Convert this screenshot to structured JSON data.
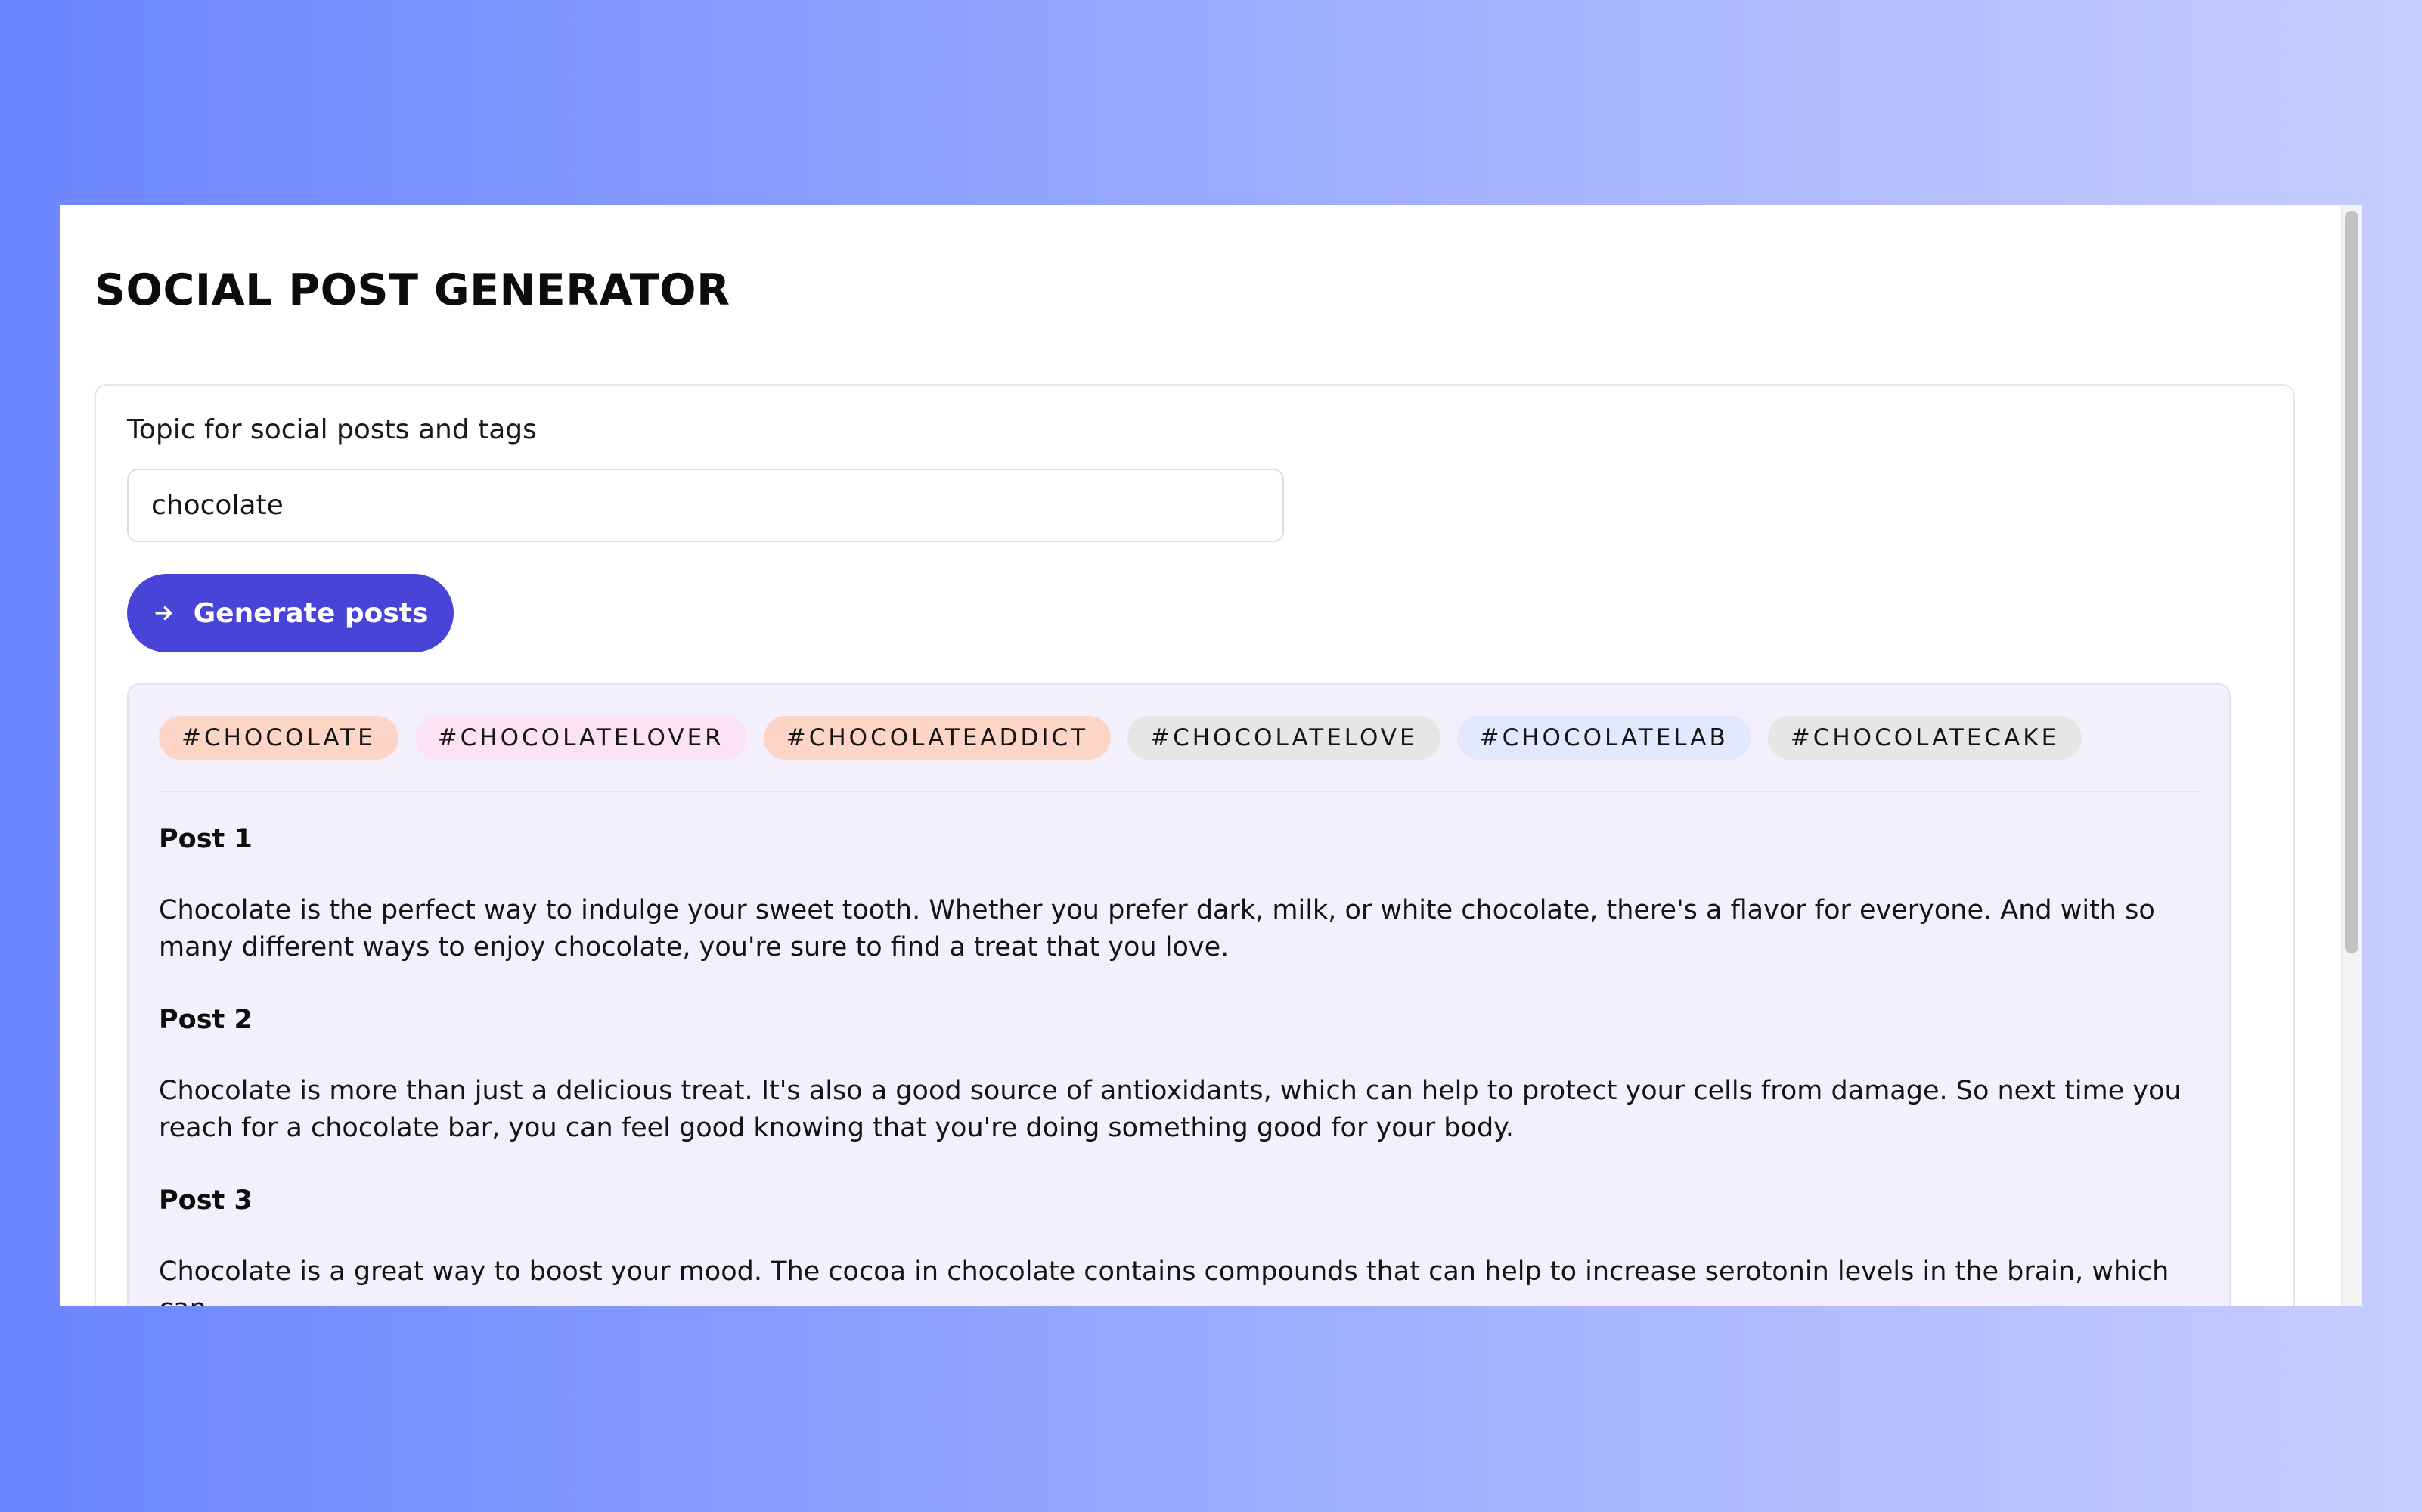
{
  "app": {
    "title": "SOCIAL POST GENERATOR"
  },
  "form": {
    "label": "Topic for social posts and tags",
    "topic_value": "chocolate",
    "generate_label": "Generate posts"
  },
  "tags": [
    {
      "label": "#CHOCOLATE",
      "color": "#fdd5c6"
    },
    {
      "label": "#CHOCOLATELOVER",
      "color": "#fbe3f4"
    },
    {
      "label": "#CHOCOLATEADDICT",
      "color": "#fdd5c6"
    },
    {
      "label": "#CHOCOLATELOVE",
      "color": "#e5e6e5"
    },
    {
      "label": "#CHOCOLATELAB",
      "color": "#e2e8fd"
    },
    {
      "label": "#CHOCOLATECAKE",
      "color": "#e5e6e5"
    }
  ],
  "posts": [
    {
      "heading": "Post 1",
      "body": "Chocolate is the perfect way to indulge your sweet tooth. Whether you prefer dark, milk, or white chocolate, there's a flavor for everyone. And with so many different ways to enjoy chocolate, you're sure to find a treat that you love."
    },
    {
      "heading": "Post 2",
      "body": "Chocolate is more than just a delicious treat. It's also a good source of antioxidants, which can help to protect your cells from damage. So next time you reach for a chocolate bar, you can feel good knowing that you're doing something good for your body."
    },
    {
      "heading": "Post 3",
      "body": "Chocolate is a great way to boost your mood. The cocoa in chocolate contains compounds that can help to increase serotonin levels in the brain, which can"
    }
  ],
  "colors": {
    "accent": "#4944d8",
    "results_background": "#f3effc"
  },
  "icons": {
    "generate_button": "arrow-right-icon"
  }
}
